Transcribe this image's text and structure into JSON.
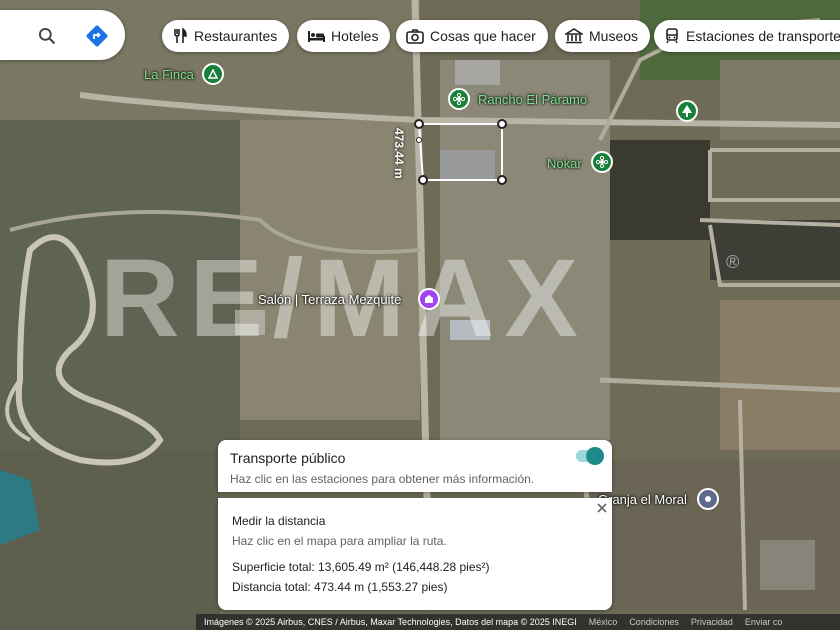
{
  "categories": [
    {
      "label": "Restaurantes",
      "icon": "fork-knife-icon"
    },
    {
      "label": "Hoteles",
      "icon": "bed-icon"
    },
    {
      "label": "Cosas que hacer",
      "icon": "camera-icon"
    },
    {
      "label": "Museos",
      "icon": "museum-icon"
    },
    {
      "label": "Estaciones de transporte",
      "icon": "transit-icon"
    }
  ],
  "places": {
    "la_finca": "La Finca",
    "rancho": "Rancho El Páramo",
    "nokar": "Nokar",
    "salon": "Salón | Terraza Mezquite",
    "granja": "Granja el Moral"
  },
  "measure_label": "473.44 m",
  "watermark": {
    "text": "RE/MAX",
    "mark": "®"
  },
  "transit_panel": {
    "title": "Transporte público",
    "subtitle": "Haz clic en las estaciones para obtener más información.",
    "toggle_on": true,
    "accent": "#1e8a8a"
  },
  "measure_panel": {
    "title": "Medir la distancia",
    "hint": "Haz clic en el mapa para ampliar la ruta.",
    "area": "Superficie total: 13,605.49 m² (146,448.28 pies²)",
    "distance": "Distancia total: 473.44 m (1,553.27 pies)"
  },
  "footer": {
    "attribution": "Imágenes © 2025 Airbus, CNES / Airbus, Maxar Technologies, Datos del mapa © 2025 INEGI",
    "links": [
      "México",
      "Condiciones",
      "Privacidad",
      "Enviar co"
    ]
  }
}
